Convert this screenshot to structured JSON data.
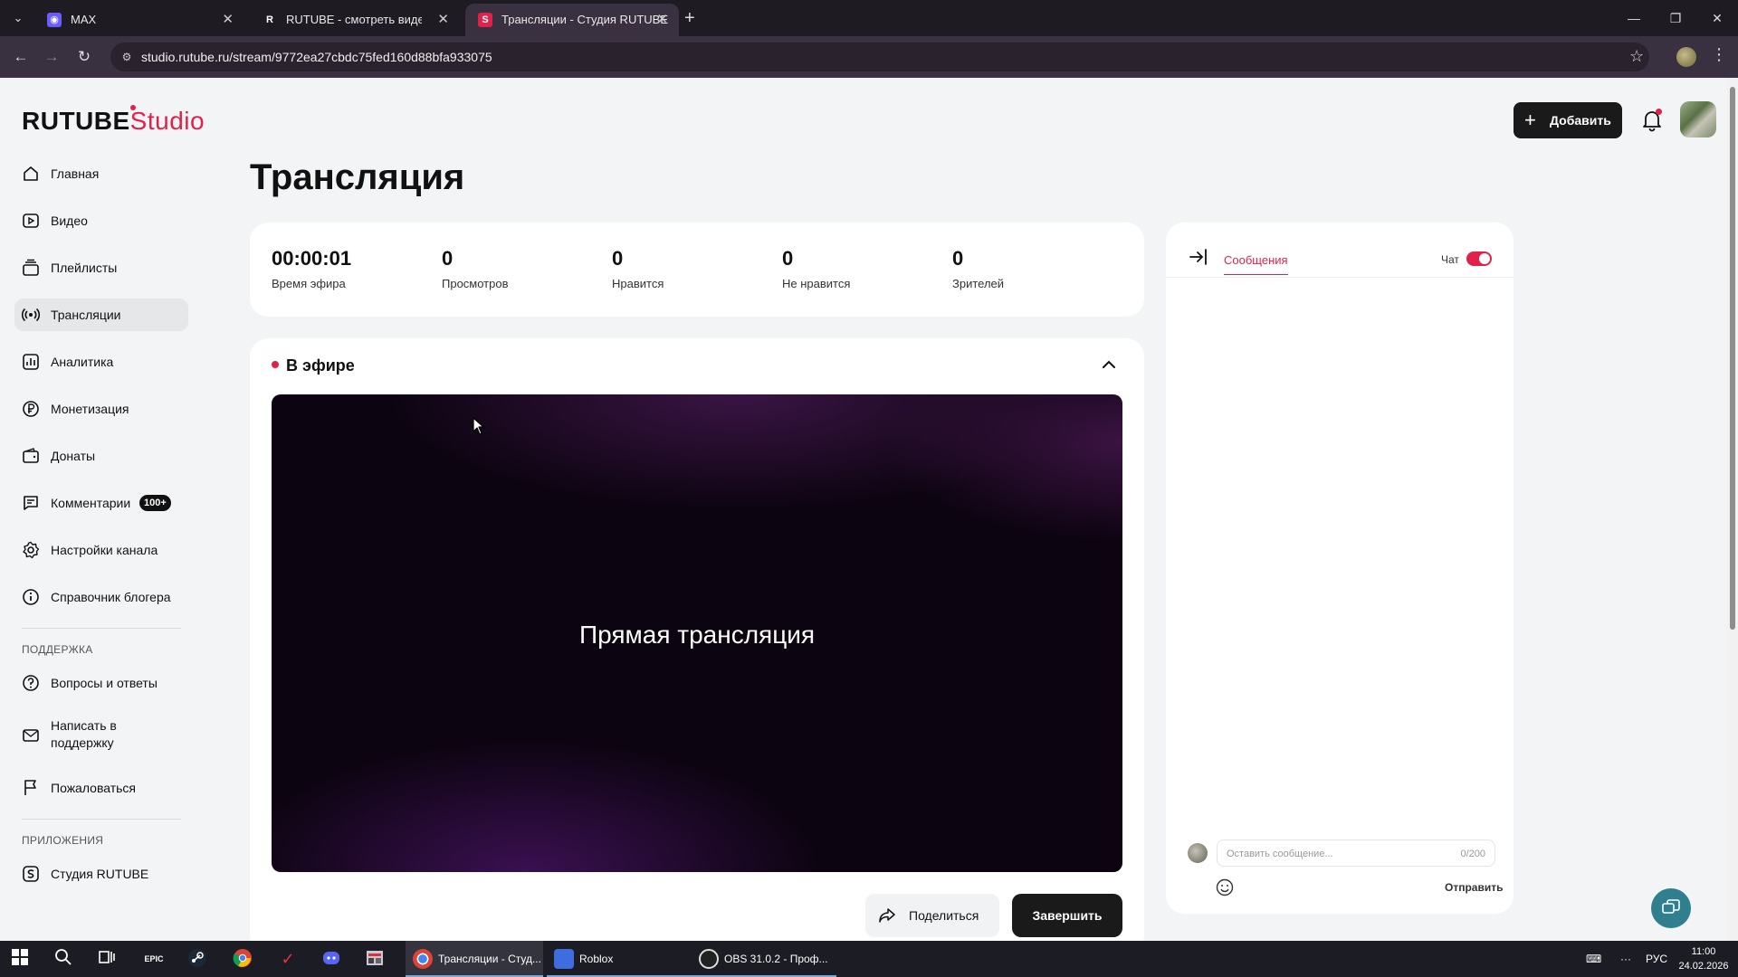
{
  "browser": {
    "tabs": [
      {
        "title": "MAX",
        "active": false
      },
      {
        "title": "RUTUBE - смотреть видео онлайн",
        "active": false
      },
      {
        "title": "Трансляции - Студия RUTUBE",
        "active": true
      }
    ],
    "url": "studio.rutube.ru/stream/9772ea27cbdc75fed160d88bfa933075"
  },
  "logo": {
    "brand": "RUTUBE",
    "product": "Studio"
  },
  "sidebar": {
    "items": [
      {
        "label": "Главная",
        "icon": "home-icon"
      },
      {
        "label": "Видео",
        "icon": "video-icon"
      },
      {
        "label": "Плейлисты",
        "icon": "playlist-icon"
      },
      {
        "label": "Трансляции",
        "icon": "broadcast-icon",
        "active": true
      },
      {
        "label": "Аналитика",
        "icon": "analytics-icon"
      },
      {
        "label": "Монетизация",
        "icon": "ruble-icon"
      },
      {
        "label": "Донаты",
        "icon": "wallet-icon"
      },
      {
        "label": "Комментарии",
        "icon": "comment-icon",
        "badge": "100+"
      },
      {
        "label": "Настройки канала",
        "icon": "gear-icon"
      },
      {
        "label": "Справочник блогера",
        "icon": "info-icon"
      }
    ],
    "support_label": "ПОДДЕРЖКА",
    "support_items": [
      {
        "label": "Вопросы и ответы",
        "icon": "question-icon"
      },
      {
        "label": "Написать в поддержку",
        "icon": "mail-icon"
      },
      {
        "label": "Пожаловаться",
        "icon": "flag-icon"
      }
    ],
    "apps_label": "ПРИЛОЖЕНИЯ",
    "apps_items": [
      {
        "label": "Студия RUTUBE",
        "icon": "studio-app-icon"
      }
    ]
  },
  "header": {
    "add_label": "Добавить"
  },
  "page": {
    "title": "Трансляция"
  },
  "stats": [
    {
      "value": "00:00:01",
      "label": "Время эфира"
    },
    {
      "value": "0",
      "label": "Просмотров"
    },
    {
      "value": "0",
      "label": "Нравится"
    },
    {
      "value": "0",
      "label": "Не нравится"
    },
    {
      "value": "0",
      "label": "Зрителей"
    }
  ],
  "live": {
    "status": "В эфире",
    "video_text": "Прямая трансляция",
    "share_label": "Поделиться",
    "finish_label": "Завершить"
  },
  "chat": {
    "tab_label": "Сообщения",
    "toggle_label": "Чат",
    "toggle_on": true,
    "input_placeholder": "Оставить сообщение...",
    "counter": "0/200",
    "send_label": "Отправить"
  },
  "taskbar": {
    "apps": [
      {
        "label": "Трансляции - Студ...",
        "icon": "chrome-icon",
        "active": true
      },
      {
        "label": "Roblox",
        "icon": "roblox-icon"
      },
      {
        "label": "OBS 31.0.2 - Проф...",
        "icon": "obs-icon"
      }
    ],
    "lang": "РУС",
    "time": "11:00",
    "date": "24.02.2026"
  },
  "colors": {
    "accent": "#e0224a",
    "dark": "#1a1a1a",
    "background": "#f3f4f6"
  }
}
